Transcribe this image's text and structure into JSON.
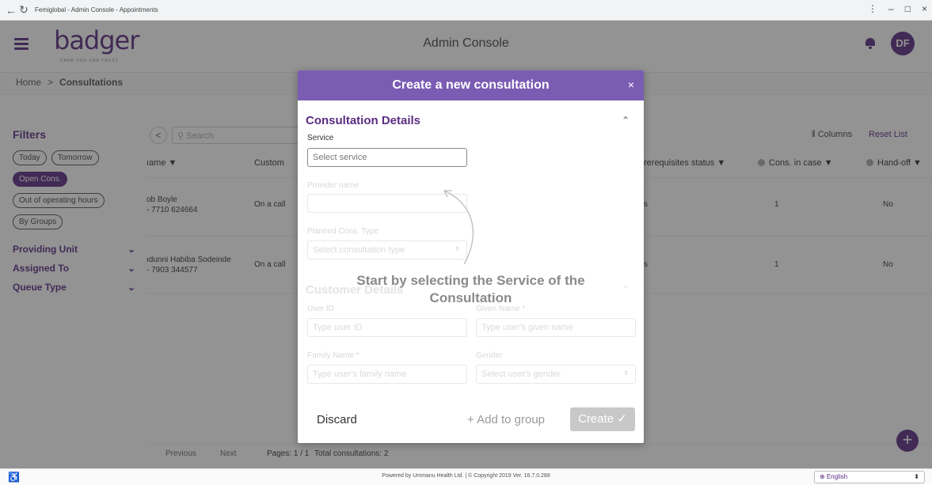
{
  "browser": {
    "tab_title": "Femiglobal - Admin Console - Appointments",
    "back_glyph": "←",
    "reload_glyph": "↻",
    "menu_glyph": "⋮",
    "minimize_glyph": "–",
    "maximize_glyph": "□",
    "close_glyph": "×"
  },
  "header": {
    "logo_text": "badger",
    "logo_subtitle": "CARE YOU CAN TRUST",
    "title": "Admin Console",
    "avatar_initials": "DF",
    "accent_color": "#5a2d82"
  },
  "breadcrumb": {
    "home": "Home",
    "separator": ">",
    "current": "Consultations"
  },
  "sidebar": {
    "title": "Filters",
    "chips": {
      "today": "Today",
      "tomorrow": "Tomorrow",
      "open_cons": "Open Cons.",
      "out_of_hours": "Out of operating hours",
      "by_groups": "By Groups"
    },
    "groups": {
      "providing_unit": "Providing Unit",
      "assigned_to": "Assigned To",
      "queue_type": "Queue Type"
    },
    "chevron": "⌄"
  },
  "toolbar": {
    "back_glyph": "<",
    "search_placeholder": "Search",
    "columns_label": "Columns",
    "reset_label": "Reset List"
  },
  "table": {
    "headers": {
      "name": "ıame ▼",
      "customer": "Custom",
      "prereq": "rerequisites status ▼",
      "cons_in_case": "Cons. in case ▼",
      "hand_off": "Hand-off ▼"
    },
    "rows": [
      {
        "name": "ob Boyle",
        "phone": "- 7710 624664",
        "customer": "On a call",
        "prereq": "s",
        "cons_in_case": "1",
        "hand_off": "No"
      },
      {
        "name": "ıdunni Habiba Sodeinde",
        "phone": "- 7903 344577",
        "customer": "On a call",
        "prereq": "s",
        "cons_in_case": "1",
        "hand_off": "No"
      }
    ]
  },
  "pagination": {
    "previous": "Previous",
    "next": "Next",
    "pages": "Pages: 1 / 1",
    "total": "Total consultations: 2"
  },
  "footer": {
    "copyright": "Powered by Ummanu Health Ltd. | © Copyright 2019 Ver. 16.7.0.288",
    "language": "English",
    "language_arrow": "⬍",
    "access_glyph": "♿"
  },
  "modal": {
    "title": "Create a new consultation",
    "close_glyph": "×",
    "consultation_section": "Consultation Details",
    "customer_section": "Customer Details",
    "section_chevron": "⌃",
    "service_label": "Service",
    "service_placeholder": "Select service",
    "provider_label": "Provider name",
    "planned_type_label": "Planned Cons. Type",
    "planned_type_placeholder": "Select consultation type",
    "user_id_label": "User ID",
    "user_id_placeholder": "Type user ID",
    "given_name_label": "Given Name *",
    "given_name_placeholder": "Type user's given name",
    "family_name_label": "Family Name *",
    "family_name_placeholder": "Type user's family name",
    "gender_label": "Gender",
    "gender_placeholder": "Select user's gender",
    "hint_line1": "Start by selecting the Service of the",
    "hint_line2": "Consultation",
    "discard_label": "Discard",
    "add_group_label": "+ Add to group",
    "create_label": "Create ✓"
  }
}
